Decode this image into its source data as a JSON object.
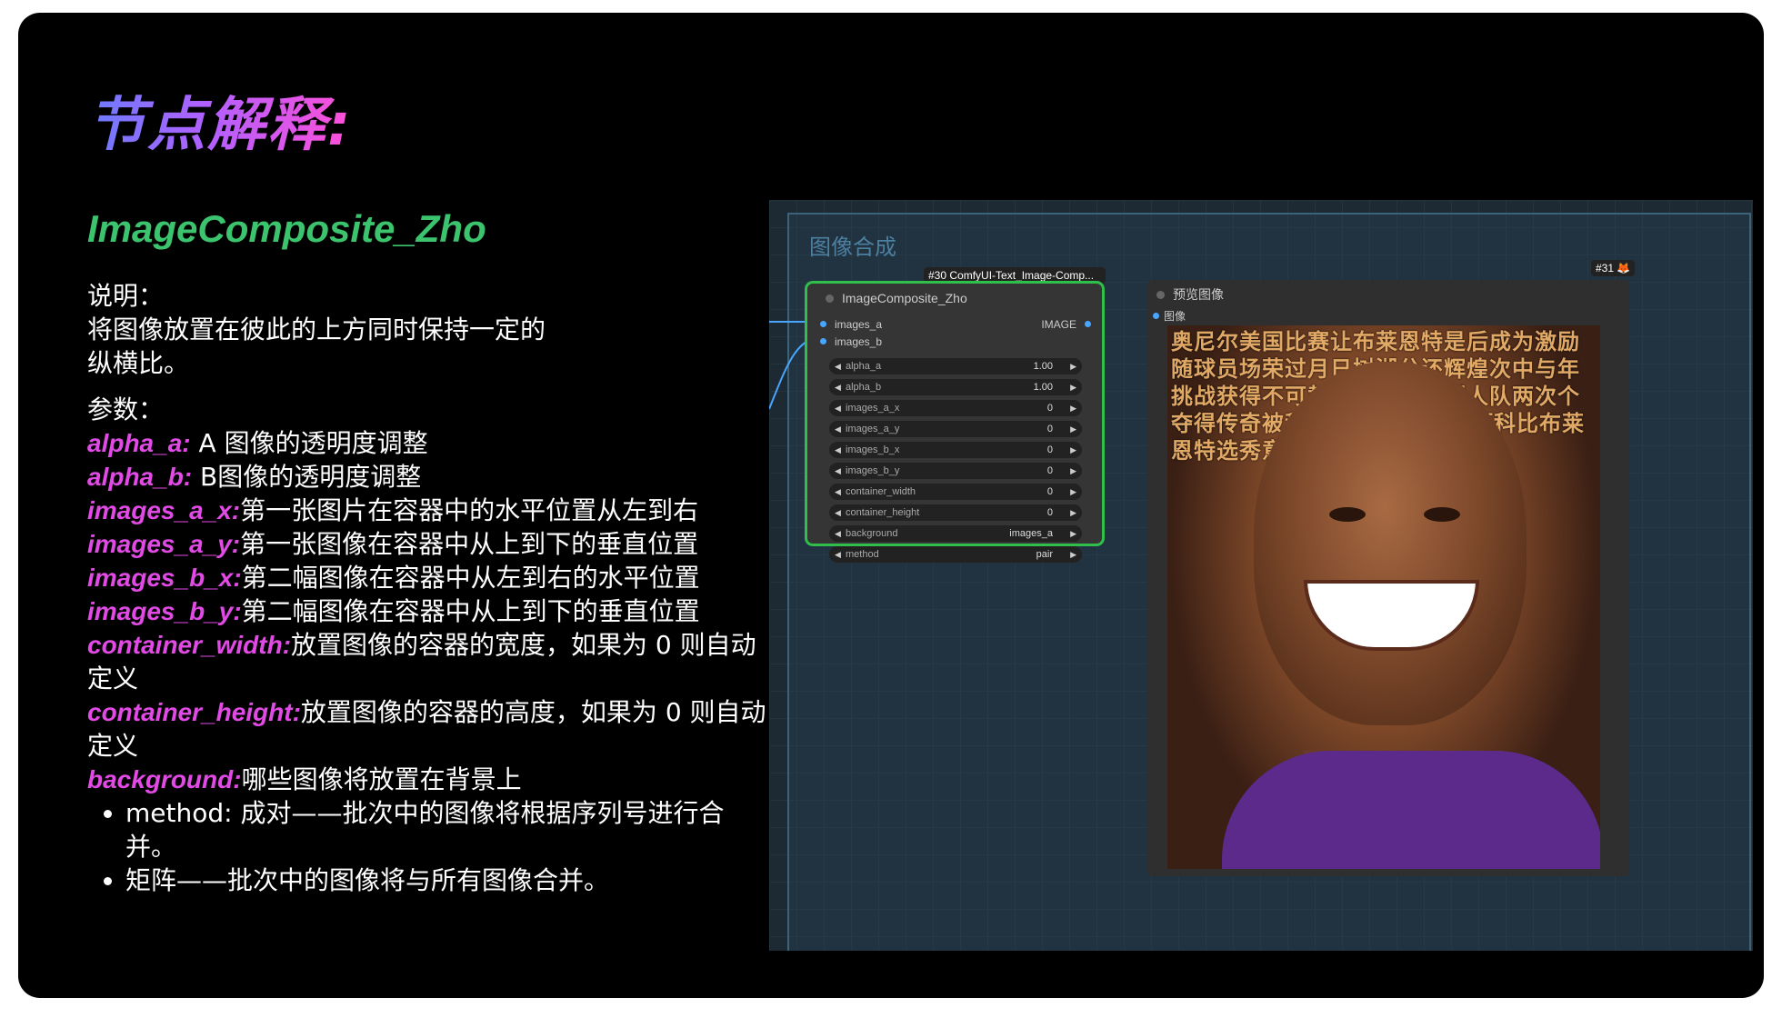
{
  "title": "节点解释:",
  "node_name": "ImageComposite_Zho",
  "description": {
    "heading": "说明：",
    "lines": [
      "将图像放置在彼此的上方同时保持一定的",
      "纵横比。"
    ]
  },
  "params": {
    "heading": "参数：",
    "items": [
      {
        "key": "alpha_a:",
        "text": " A 图像的透明度调整"
      },
      {
        "key": "alpha_b:",
        "text": " B图像的透明度调整"
      },
      {
        "key": "images_a_x:",
        "text": "第一张图片在容器中的水平位置从左到右"
      },
      {
        "key": "images_a_y:",
        "text": "第一张图像在容器中从上到下的垂直位置"
      },
      {
        "key": "images_b_x:",
        "text": "第二幅图像在容器中从左到右的水平位置"
      },
      {
        "key": "images_b_y:",
        "text": "第二幅图像在容器中从上到下的垂直位置"
      },
      {
        "key": "container_width:",
        "text": "放置图像的容器的宽度，如果为 0 则自动",
        "cont": "定义"
      },
      {
        "key": "container_height:",
        "text": "放置图像的容器的高度，如果为 0 则自动",
        "cont": "定义"
      },
      {
        "key": "background:",
        "text": "哪些图像将放置在背景上"
      }
    ],
    "bullets": [
      "method: 成对——批次中的图像将根据序列号进行合并。",
      "矩阵——批次中的图像将与所有图像合并。"
    ]
  },
  "canvas": {
    "group_title": "图像合成",
    "node30": {
      "tag": "#30 ComfyUI-Text_Image-Comp...",
      "title": "ImageComposite_Zho",
      "inputs": [
        "images_a",
        "images_b"
      ],
      "output": "IMAGE",
      "widgets": [
        {
          "label": "alpha_a",
          "value": "1.00"
        },
        {
          "label": "alpha_b",
          "value": "1.00"
        },
        {
          "label": "images_a_x",
          "value": "0"
        },
        {
          "label": "images_a_y",
          "value": "0"
        },
        {
          "label": "images_b_x",
          "value": "0"
        },
        {
          "label": "images_b_y",
          "value": "0"
        },
        {
          "label": "container_width",
          "value": "0"
        },
        {
          "label": "container_height",
          "value": "0"
        },
        {
          "label": "background",
          "value": "images_a"
        },
        {
          "label": "method",
          "value": "pair"
        }
      ]
    },
    "node31": {
      "tag": "#31 🦊",
      "title": "预览图像",
      "input": "图像",
      "wordwall": "奥尼尔美国比赛让布莱恩特是后成为激励随球员场荣过月日树湖分还辉煌次中与年挑战获得不可替代无数精神湖人队两次个夺得传奇被称比以NBA职业生涯科比布莱恩特选秀意大利"
    }
  }
}
